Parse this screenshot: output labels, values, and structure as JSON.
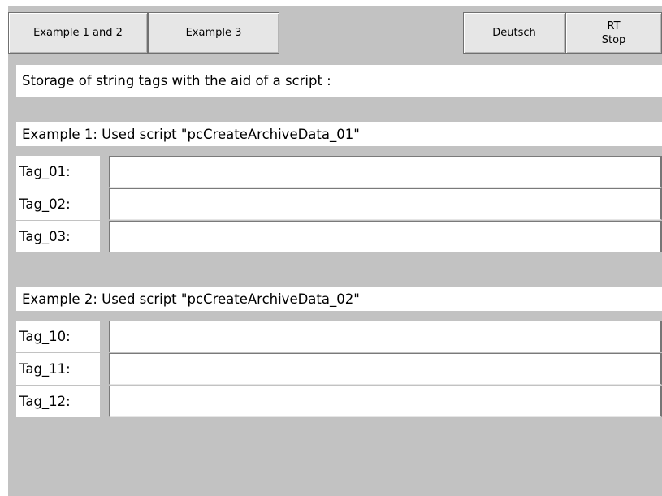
{
  "toolbar": {
    "example12_label": "Example 1 and 2",
    "example3_label": "Example 3",
    "deutsch_label": "Deutsch",
    "rt_stop_label": "RT\nStop"
  },
  "heading": "Storage of string tags with the aid of a script :",
  "example1": {
    "title": "Example 1: Used script \"pcCreateArchiveData_01\"",
    "rows": [
      {
        "label": "Tag_01:",
        "value": ""
      },
      {
        "label": "Tag_02:",
        "value": ""
      },
      {
        "label": "Tag_03:",
        "value": ""
      }
    ]
  },
  "example2": {
    "title": "Example 2: Used script \"pcCreateArchiveData_02\"",
    "rows": [
      {
        "label": "Tag_10:",
        "value": ""
      },
      {
        "label": "Tag_11:",
        "value": ""
      },
      {
        "label": "Tag_12:",
        "value": ""
      }
    ]
  },
  "colors": {
    "background": "#c2c2c2",
    "button_face": "#e6e6e6",
    "panel": "#ffffff"
  }
}
